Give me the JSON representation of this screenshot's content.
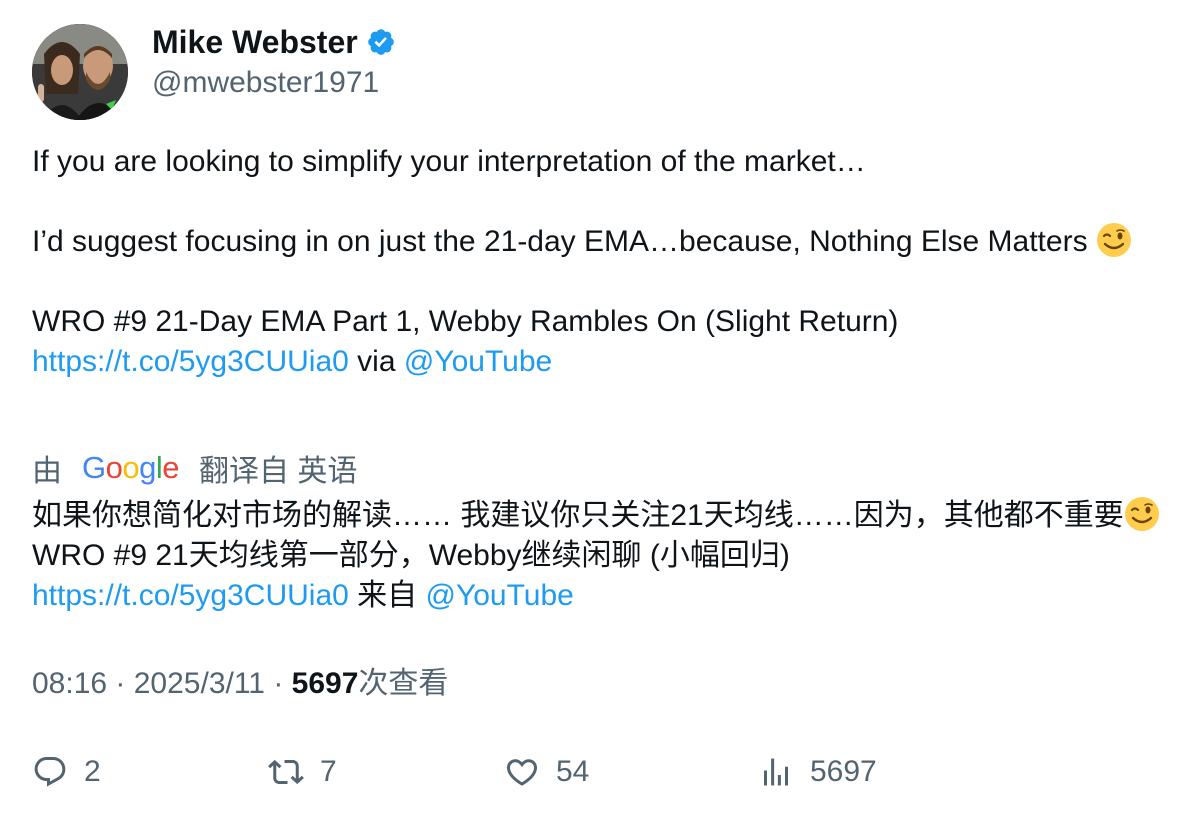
{
  "author": {
    "name": "Mike Webster",
    "handle": "@mwebster1971",
    "verified_icon": "verified-badge-icon",
    "verified_color": "#1d9bf0"
  },
  "tweet": {
    "line1": "If you are looking to simplify your interpretation of the market…",
    "line2": "I’d suggest focusing in on just the 21-day EMA…because, Nothing Else Matters",
    "emoji": "winking-face-emoji",
    "line3": "WRO #9 21-Day EMA Part 1, Webby Rambles On (Slight Return)",
    "link": "https://t.co/5yg3CUUia0",
    "via": "via",
    "mention": "@YouTube"
  },
  "translation": {
    "prefix": "由",
    "google_letters": [
      "G",
      "o",
      "o",
      "g",
      "l",
      "e"
    ],
    "label": "翻译自 英语",
    "text_part1": "如果你想简化对市场的解读…… 我建议你只关注21天均线……因为，其他都不重要",
    "text_part2": " WRO #9 21天均线第一部分，Webby继续闲聊 (小幅回归)",
    "link": "https://t.co/5yg3CUUia0",
    "from": "来自",
    "mention": "@YouTube"
  },
  "meta": {
    "time": "08:16",
    "sep1": " · ",
    "date": "2025/3/11",
    "sep2": " · ",
    "views": "5697",
    "views_label": "次查看"
  },
  "actions": {
    "replies": "2",
    "retweets": "7",
    "likes": "54",
    "views": "5697"
  },
  "colors": {
    "text": "#0f1419",
    "secondary": "#536471",
    "link": "#1d9bf0"
  }
}
